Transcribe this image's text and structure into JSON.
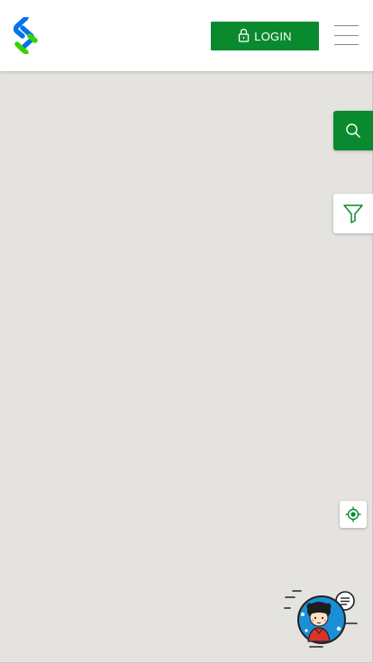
{
  "header": {
    "logo_icon": "standard-chartered-logo",
    "login_label": "LOGIN",
    "login_icon": "lock-icon",
    "menu_icon": "hamburger-menu-icon"
  },
  "map": {
    "search_icon": "search-icon",
    "filter_icon": "filter-icon",
    "locate_icon": "locate-me-icon",
    "chatbot_icon": "chatbot-assistant-icon"
  },
  "colors": {
    "brand_green": "#0a8a2e",
    "logo_blue": "#0473ea",
    "logo_green": "#38d200",
    "map_background": "#e5e3df",
    "header_background": "#ffffff"
  }
}
